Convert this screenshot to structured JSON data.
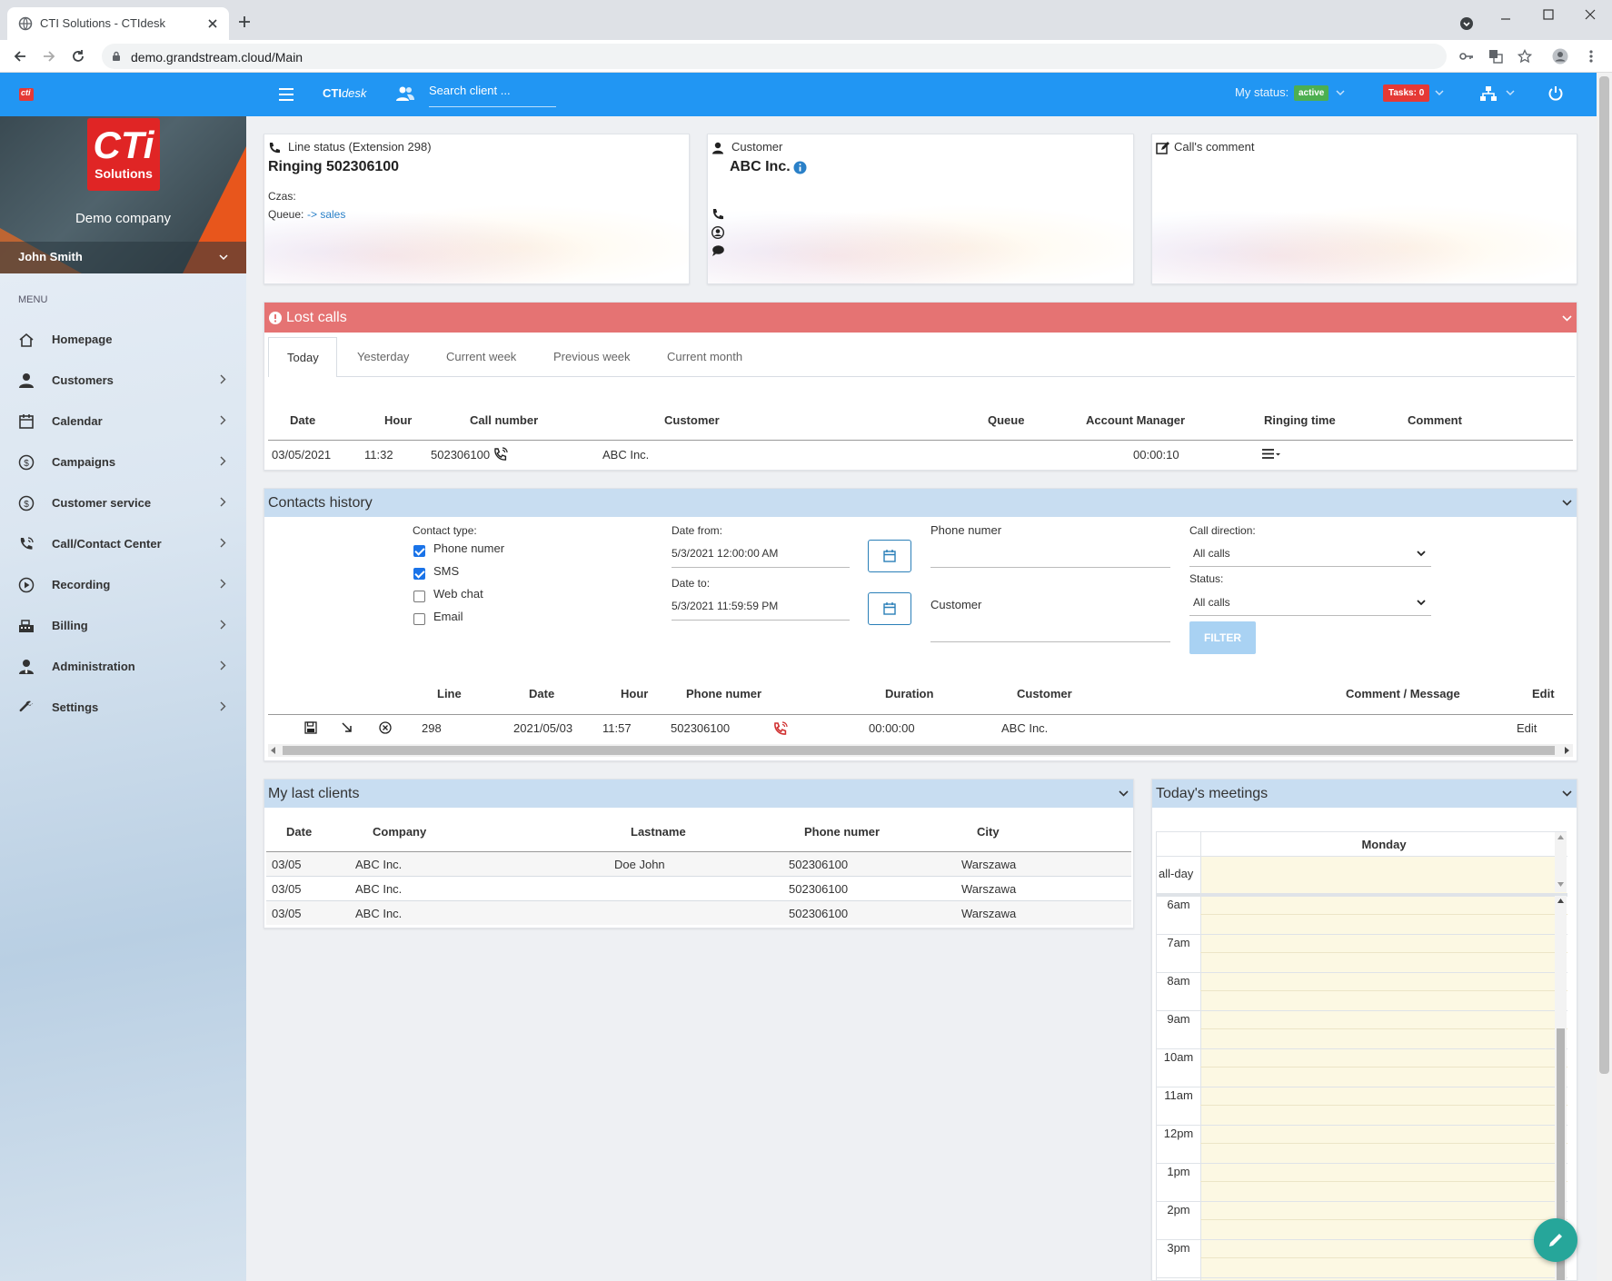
{
  "browser": {
    "tab_title": "CTI Solutions - CTIdesk",
    "url": "demo.grandstream.cloud/Main"
  },
  "appbar": {
    "brand": "CTIdesk",
    "brand_prefix": "CTI",
    "brand_suffix": "desk",
    "search_placeholder": "Search client ...",
    "my_status_label": "My status:",
    "status_badge": "active",
    "tasks_badge": "Tasks: 0"
  },
  "sidebar": {
    "logo_big": "CTi",
    "logo_small": "Solutions",
    "company": "Demo company",
    "user": "John Smith",
    "menu_label": "MENU",
    "items": [
      {
        "label": "Homepage",
        "icon": "home-icon"
      },
      {
        "label": "Customers",
        "icon": "user-icon"
      },
      {
        "label": "Calendar",
        "icon": "calendar-icon"
      },
      {
        "label": "Campaigns",
        "icon": "dollar-icon"
      },
      {
        "label": "Customer service",
        "icon": "dollar-icon"
      },
      {
        "label": "Call/Contact Center",
        "icon": "phone-volume-icon"
      },
      {
        "label": "Recording",
        "icon": "play-circle-icon"
      },
      {
        "label": "Billing",
        "icon": "cash-register-icon"
      },
      {
        "label": "Administration",
        "icon": "user-tie-icon"
      },
      {
        "label": "Settings",
        "icon": "wrench-icon"
      }
    ]
  },
  "line_status": {
    "title": "Line status (Extension 298)",
    "main": "Ringing 502306100",
    "czas_label": "Czas:",
    "queue_label": "Queue:",
    "queue_value": "-> sales"
  },
  "customer_card": {
    "title": "Customer",
    "name": "ABC Inc."
  },
  "comment_card": {
    "title": "Call's comment"
  },
  "lost_calls": {
    "title": "Lost calls",
    "tabs": [
      "Today",
      "Yesterday",
      "Current week",
      "Previous week",
      "Current month"
    ],
    "columns": [
      "Date",
      "Hour",
      "Call number",
      "Customer",
      "Queue",
      "Account Manager",
      "Ringing time",
      "Comment"
    ],
    "rows": [
      {
        "date": "03/05/2021",
        "hour": "11:32",
        "number": "502306100",
        "customer": "ABC Inc.",
        "queue": "",
        "manager": "",
        "ringing": "00:00:10"
      }
    ]
  },
  "contacts_history": {
    "title": "Contacts history",
    "contact_type_label": "Contact type:",
    "types": [
      {
        "label": "Phone numer",
        "checked": true
      },
      {
        "label": "SMS",
        "checked": true
      },
      {
        "label": "Web chat",
        "checked": false
      },
      {
        "label": "Email",
        "checked": false
      }
    ],
    "date_from_label": "Date from:",
    "date_from_value": "5/3/2021 12:00:00 AM",
    "date_to_label": "Date to:",
    "date_to_value": "5/3/2021 11:59:59 PM",
    "phone_label": "Phone numer",
    "customer_label": "Customer",
    "direction_label": "Call direction:",
    "direction_value": "All calls",
    "status_label": "Status:",
    "status_value": "All calls",
    "filter_button": "FILTER",
    "columns": [
      "Line",
      "Date",
      "Hour",
      "Phone numer",
      "Duration",
      "Customer",
      "Comment / Message",
      "Edit"
    ],
    "rows": [
      {
        "line": "298",
        "date": "2021/05/03",
        "hour": "11:57",
        "phone": "502306100",
        "duration": "00:00:00",
        "customer": "ABC Inc.",
        "edit": "Edit"
      }
    ]
  },
  "last_clients": {
    "title": "My last clients",
    "columns": [
      "Date",
      "Company",
      "Lastname",
      "Phone numer",
      "City"
    ],
    "rows": [
      {
        "date": "03/05",
        "company": "ABC Inc.",
        "lastname": "Doe John",
        "phone": "502306100",
        "city": "Warszawa"
      },
      {
        "date": "03/05",
        "company": "ABC Inc.",
        "lastname": "",
        "phone": "502306100",
        "city": "Warszawa"
      },
      {
        "date": "03/05",
        "company": "ABC Inc.",
        "lastname": "",
        "phone": "502306100",
        "city": "Warszawa"
      }
    ]
  },
  "meetings": {
    "title": "Today's meetings",
    "day": "Monday",
    "allday": "all-day",
    "hours": [
      "6am",
      "7am",
      "8am",
      "9am",
      "10am",
      "11am",
      "12pm",
      "1pm",
      "2pm",
      "3pm"
    ]
  },
  "colors": {
    "appbar": "#2196f3",
    "lost_calls_header": "#e57373",
    "panel_header": "#c8ddf1",
    "link": "#2a80c8",
    "danger": "#d03030",
    "status_active": "#4caf50",
    "tasks": "#e53935",
    "fab": "#26a69a"
  }
}
